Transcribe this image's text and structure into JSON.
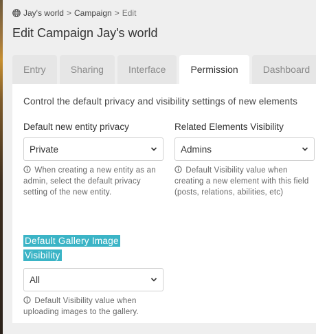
{
  "breadcrumb": {
    "items": [
      "Jay's world",
      "Campaign",
      "Edit"
    ],
    "separator": ">"
  },
  "page": {
    "title": "Edit Campaign Jay's world"
  },
  "tabs": [
    {
      "label": "Entry",
      "active": false
    },
    {
      "label": "Sharing",
      "active": false
    },
    {
      "label": "Interface",
      "active": false
    },
    {
      "label": "Permission",
      "active": true
    },
    {
      "label": "Dashboard",
      "active": false
    }
  ],
  "permission": {
    "intro": "Control the default privacy and visibility settings of new elements",
    "entity_privacy": {
      "label": "Default new entity privacy",
      "value": "Private",
      "help": "When creating a new entity as an admin, select the default privacy setting of the new entity."
    },
    "related_visibility": {
      "label": "Related Elements Visibility",
      "value": "Admins",
      "help": "Default Visibility value when creating a new element with this field (posts, relations, abilities, etc)"
    },
    "gallery_visibility": {
      "label": "Default Gallery Image Visibility",
      "value": "All",
      "help": "Default Visibility value when uploading images to the gallery."
    }
  },
  "icons": {
    "breadcrumb": "globe-icon",
    "help": "info-circle-icon",
    "select": "chevron-down-icon"
  },
  "colors": {
    "highlight": "#3bb4c6",
    "active_tab": "#ffffff",
    "inactive_tab": "#e6e6e6",
    "background": "#efefef"
  }
}
